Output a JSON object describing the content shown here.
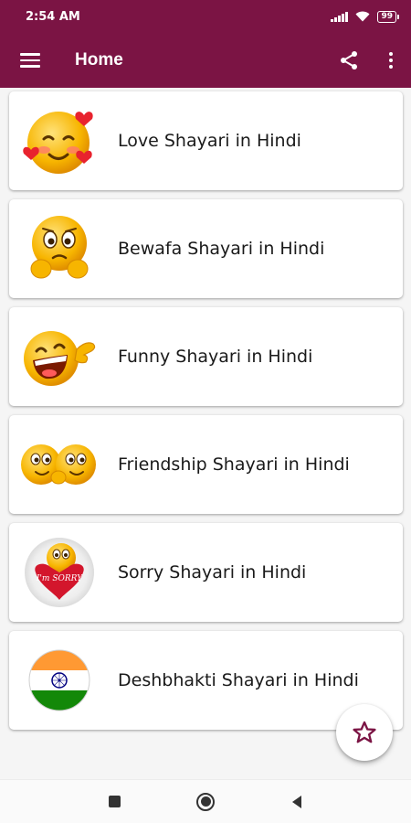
{
  "status_bar": {
    "time": "2:54 AM",
    "battery": "99"
  },
  "app_bar": {
    "title": "Home",
    "menu_icon": "hamburger-menu-icon",
    "share_icon": "share-icon",
    "more_icon": "more-vert-icon"
  },
  "categories": [
    {
      "label": "Love Shayari in Hindi",
      "icon": "love-emoji-icon"
    },
    {
      "label": "Bewafa Shayari in Hindi",
      "icon": "sad-emoji-icon"
    },
    {
      "label": "Funny Shayari in Hindi",
      "icon": "laughing-emoji-icon"
    },
    {
      "label": "Friendship Shayari in Hindi",
      "icon": "friendship-emoji-icon"
    },
    {
      "label": "Sorry Shayari in Hindi",
      "icon": "sorry-emoji-icon"
    },
    {
      "label": "Deshbhakti Shayari in Hindi",
      "icon": "india-flag-icon"
    }
  ],
  "sorry_heart_text": "I'm SORRY",
  "fab_icon": "star-icon",
  "colors": {
    "primary": "#7b1444",
    "accent": "#7b1444"
  },
  "nav_bar": [
    "square-recents-icon",
    "circle-home-icon",
    "triangle-back-icon"
  ]
}
